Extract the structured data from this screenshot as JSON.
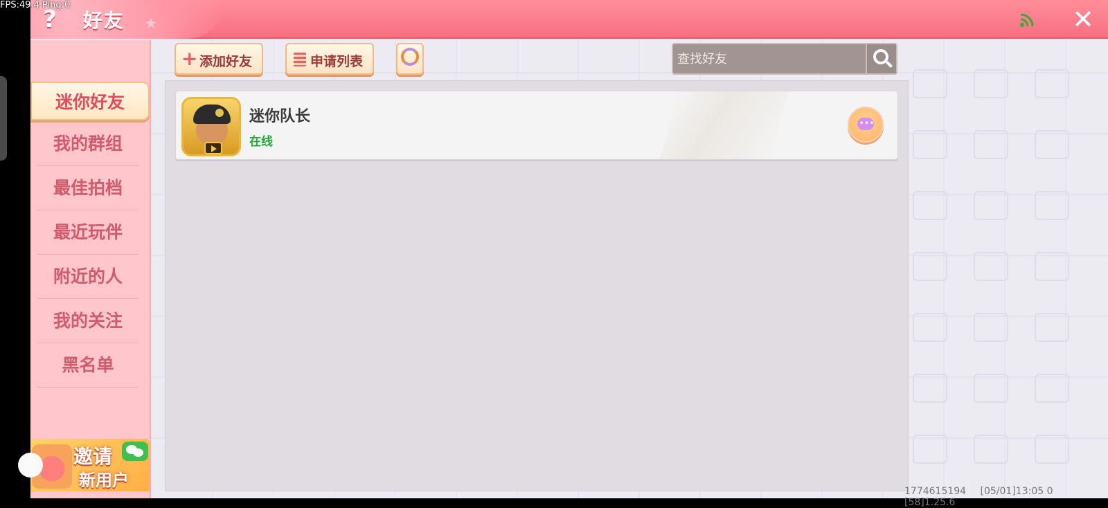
{
  "overlay": {
    "fps": "FPS:49.4  Ping:0"
  },
  "header": {
    "title": "好友",
    "help_icon": "?",
    "close_icon": "✕",
    "signal_icon": "wifi-signal-icon"
  },
  "sidebar": {
    "items": [
      {
        "label": "迷你好友",
        "active": true
      },
      {
        "label": "我的群组",
        "active": false
      },
      {
        "label": "最佳拍档",
        "active": false
      },
      {
        "label": "最近玩伴",
        "active": false
      },
      {
        "label": "附近的人",
        "active": false
      },
      {
        "label": "我的关注",
        "active": false
      },
      {
        "label": "黑名单",
        "active": false
      }
    ],
    "invite": {
      "line1": "邀请",
      "line2": "新用户"
    }
  },
  "toolbar": {
    "add_friend_label": "添加好友",
    "request_list_label": "申请列表"
  },
  "search": {
    "placeholder": "查找好友",
    "value": ""
  },
  "friends": [
    {
      "name": "迷你队长",
      "status": "在线",
      "status_color": "#22a83b"
    }
  ],
  "footer": {
    "id": "1774615194",
    "build": "[05/01]13:05 0",
    "version": "[58]1.25.6"
  },
  "colors": {
    "header_bg": "#f86f80",
    "sidebar_bg": "#ffc7cc",
    "accent_text": "#d05b6c",
    "online": "#22a83b"
  }
}
